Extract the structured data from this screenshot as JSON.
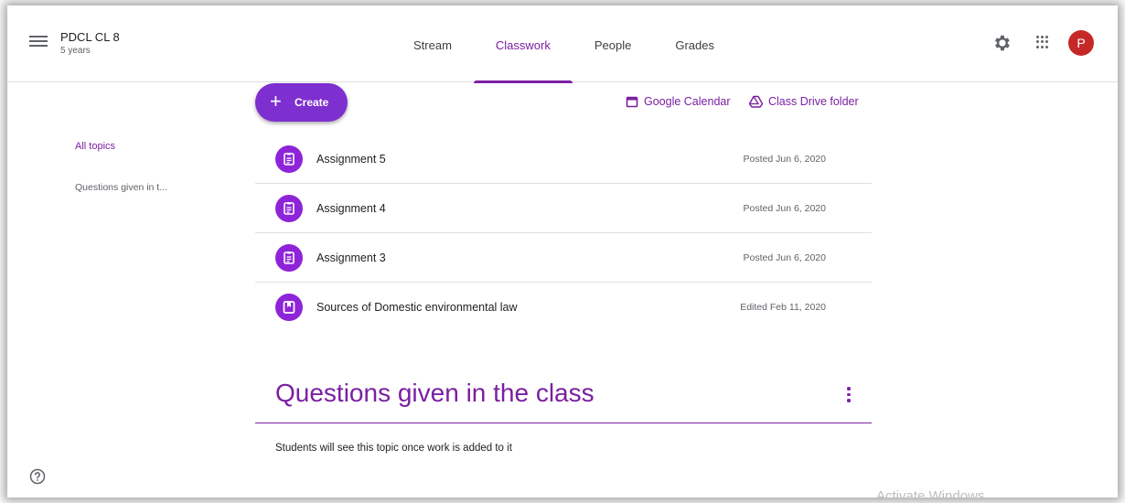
{
  "header": {
    "class_name": "PDCL CL 8",
    "class_sub": "5 years",
    "tabs": [
      "Stream",
      "Classwork",
      "People",
      "Grades"
    ],
    "active_tab": "Classwork",
    "avatar_letter": "P"
  },
  "actions": {
    "create_label": "Create",
    "calendar_label": "Google Calendar",
    "drive_label": "Class Drive folder"
  },
  "sidebar": {
    "all_topics": "All topics",
    "topic_item": "Questions given in t..."
  },
  "items": [
    {
      "title": "Assignment 5",
      "meta": "Posted Jun 6, 2020",
      "icon": "assignment-icon"
    },
    {
      "title": "Assignment 4",
      "meta": "Posted Jun 6, 2020",
      "icon": "assignment-icon"
    },
    {
      "title": "Assignment 3",
      "meta": "Posted Jun 6, 2020",
      "icon": "assignment-icon"
    },
    {
      "title": "Sources of Domestic environmental law",
      "meta": "Edited Feb 11, 2020",
      "icon": "material-icon"
    }
  ],
  "topic": {
    "title": "Questions given in the class",
    "note": "Students will see this topic once work is added to it"
  },
  "watermark": "Activate Windows",
  "colors": {
    "accent": "#7b1fa2",
    "avatar": "#c62828",
    "icon_bg": "#8e24d8"
  }
}
